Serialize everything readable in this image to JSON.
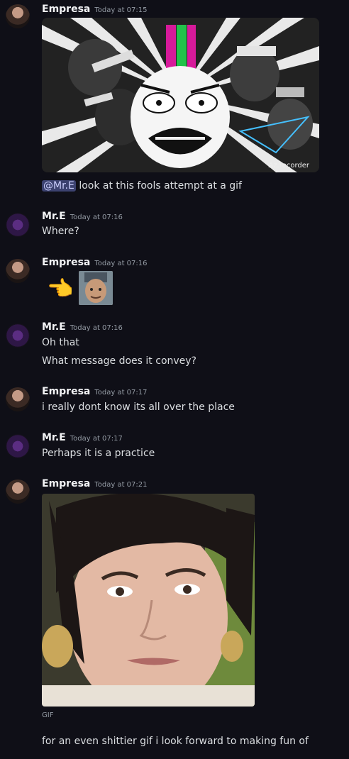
{
  "messages": [
    {
      "author": "Empresa",
      "time": "Today at 07:15",
      "mention": "@Mr.E",
      "text": "look at this fools attempt at a gif",
      "image_watermark": "Az.recorder"
    },
    {
      "author": "Mr.E",
      "time": "Today at 07:16",
      "text": "Where?"
    },
    {
      "author": "Empresa",
      "time": "Today at 07:16",
      "emoji": "👈"
    },
    {
      "author": "Mr.E",
      "time": "Today at 07:16",
      "text": "Oh that",
      "text2": "What message does it convey?"
    },
    {
      "author": "Empresa",
      "time": "Today at 07:17",
      "text": "i really dont know its all over the place"
    },
    {
      "author": "Mr.E",
      "time": "Today at 07:17",
      "text": "Perhaps it is a practice"
    },
    {
      "author": "Empresa",
      "time": "Today at 07:21",
      "gif_label": "GIF",
      "text": "for an even shittier gif i look forward to making fun of"
    }
  ],
  "colors": {
    "background": "#0f0f17",
    "mention_bg": "#3c4270",
    "username": "#f2f3f5",
    "timestamp": "#949ba4"
  }
}
